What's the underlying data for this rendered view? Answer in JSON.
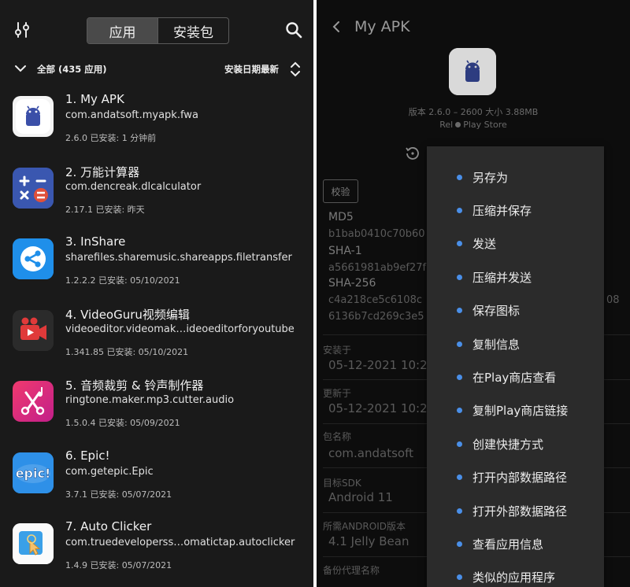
{
  "left": {
    "tabs": [
      {
        "label": "应用",
        "active": true
      },
      {
        "label": "安装包",
        "active": false
      }
    ],
    "app_count": "全部 (435 应用)",
    "sort_label": "安装日期最新",
    "apps": [
      {
        "name": "1. My APK",
        "package": "com.andatsoft.myapk.fwa",
        "meta": "2.6.0   已安装: 1 分钟前"
      },
      {
        "name": "2. 万能计算器",
        "package": "com.dencreak.dlcalculator",
        "meta": "2.17.1   已安装: 昨天"
      },
      {
        "name": "3. InShare",
        "package": "sharefiles.sharemusic.shareapps.filetransfer",
        "meta": "1.2.2.2   已安装: 05/10/2021"
      },
      {
        "name": "4. VideoGuru视频编辑",
        "package": "videoeditor.videomak…ideoeditorforyoutube",
        "meta": "1.341.85   已安装: 05/10/2021"
      },
      {
        "name": "5. 音频裁剪 & 铃声制作器",
        "package": "ringtone.maker.mp3.cutter.audio",
        "meta": "1.5.0.4   已安装: 05/09/2021"
      },
      {
        "name": "6. Epic!",
        "package": "com.getepic.Epic",
        "meta": "3.7.1   已安装: 05/07/2021"
      },
      {
        "name": "7. Auto Clicker",
        "package": "com.truedeveloperss…omatictap.autoclicker",
        "meta": "1.4.9   已安装: 05/07/2021"
      }
    ]
  },
  "right": {
    "title": "My APK",
    "version_line": "版本 2.6.0 – 2600 大小 3.88MB",
    "source_rel": "Rel",
    "source_store": "Play Store",
    "verify_button": "校验",
    "hashes": [
      {
        "label": "MD5",
        "value": "b1bab0410c70b60"
      },
      {
        "label": "SHA-1",
        "value": "a5661981ab9ef27f"
      },
      {
        "label": "SHA-256",
        "value": "c4a218ce5c6108c",
        "value2": "6136b7cd269c3e5",
        "tail": "08"
      }
    ],
    "info": [
      {
        "label": "安装于",
        "value": "05-12-2021 10:2"
      },
      {
        "label": "更新于",
        "value": "05-12-2021 10:2"
      },
      {
        "label": "包名称",
        "value": "com.andatsoft"
      },
      {
        "label": "目标SDK",
        "value": "Android 11"
      },
      {
        "label": "所需ANDROID版本",
        "value": "4.1 Jelly Bean"
      },
      {
        "label": "备份代理名称",
        "value": ""
      }
    ],
    "menu": [
      "另存为",
      "压缩并保存",
      "发送",
      "压缩并发送",
      "保存图标",
      "复制信息",
      "在Play商店查看",
      "复制Play商店链接",
      "创建快捷方式",
      "打开内部数据路径",
      "打开外部数据路径",
      "查看应用信息",
      "类似的应用程序"
    ]
  },
  "colors": {
    "accent": "#4a8fe8",
    "background": "#1a1a1a"
  }
}
